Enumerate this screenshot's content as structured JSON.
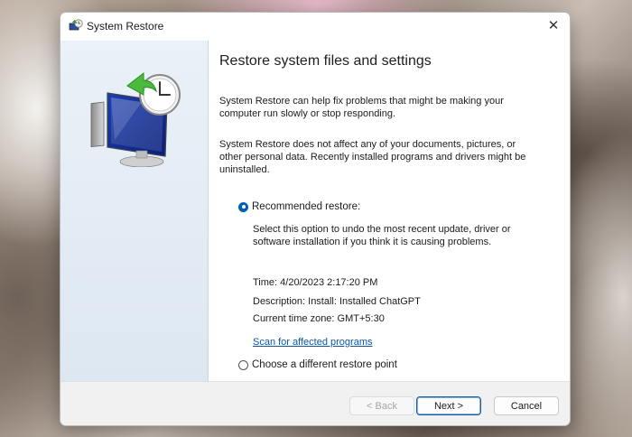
{
  "window": {
    "title": "System Restore",
    "close_glyph": "✕"
  },
  "content": {
    "heading": "Restore system files and settings",
    "paragraph1": "System Restore can help fix problems that might be making your computer run slowly or stop responding.",
    "paragraph2": "System Restore does not affect any of your documents, pictures, or other personal data. Recently installed programs and drivers might be uninstalled.",
    "options": {
      "recommended_label": "Recommended restore:",
      "recommended_selected": true,
      "recommended_description": "Select this option to undo the most recent update, driver or software installation if you think it is causing problems.",
      "different_label": "Choose a different restore point",
      "different_selected": false
    },
    "restore_info": {
      "time": "Time: 4/20/2023 2:17:20 PM",
      "description": "Description: Install: Installed ChatGPT",
      "timezone": "Current time zone: GMT+5:30"
    },
    "scan_link": "Scan for affected programs"
  },
  "buttons": {
    "back": "< Back",
    "next": "Next >",
    "cancel": "Cancel"
  },
  "colors": {
    "accent": "#005fb8",
    "link": "#0b57a4"
  }
}
